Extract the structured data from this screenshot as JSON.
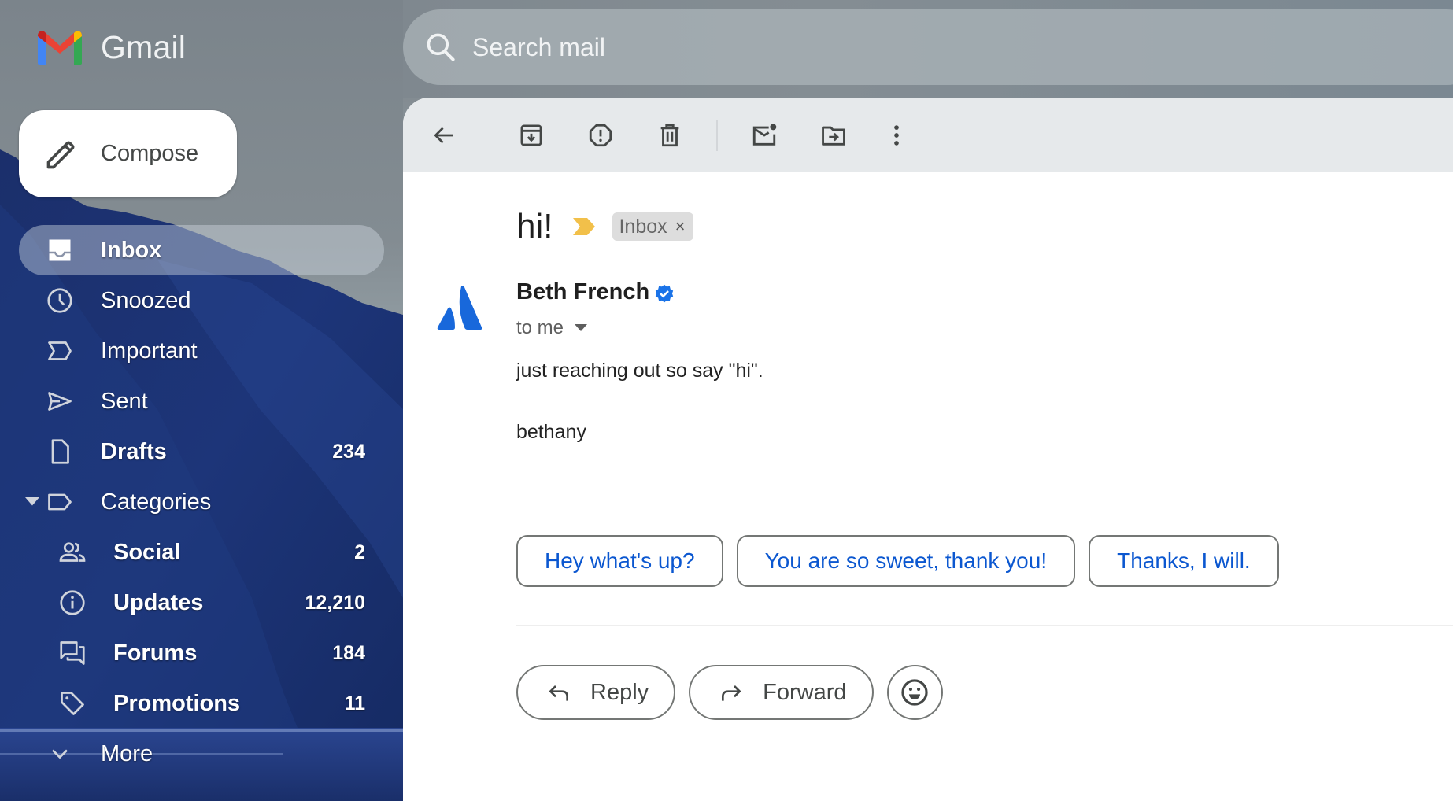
{
  "app": {
    "name": "Gmail",
    "logo_icon": "gmail-m-logo"
  },
  "search": {
    "placeholder": "Search mail",
    "value": "",
    "icon": "search-icon"
  },
  "compose": {
    "label": "Compose",
    "icon": "pencil-icon"
  },
  "sidebar": {
    "items": [
      {
        "label": "Inbox",
        "icon": "inbox-icon",
        "count": "",
        "active": true,
        "bold": true
      },
      {
        "label": "Snoozed",
        "icon": "clock-icon",
        "count": "",
        "active": false,
        "bold": false
      },
      {
        "label": "Important",
        "icon": "important-icon",
        "count": "",
        "active": false,
        "bold": false
      },
      {
        "label": "Sent",
        "icon": "send-icon",
        "count": "",
        "active": false,
        "bold": false
      },
      {
        "label": "Drafts",
        "icon": "draft-icon",
        "count": "234",
        "active": false,
        "bold": true
      },
      {
        "label": "Categories",
        "icon": "label-icon",
        "count": "",
        "active": false,
        "bold": false,
        "expanded": true
      },
      {
        "label": "Social",
        "icon": "people-icon",
        "count": "2",
        "active": false,
        "bold": true
      },
      {
        "label": "Updates",
        "icon": "info-icon",
        "count": "12,210",
        "active": false,
        "bold": true
      },
      {
        "label": "Forums",
        "icon": "forum-icon",
        "count": "184",
        "active": false,
        "bold": true
      },
      {
        "label": "Promotions",
        "icon": "tag-icon",
        "count": "11",
        "active": false,
        "bold": true
      },
      {
        "label": "More",
        "icon": "chevron-down-icon",
        "count": "",
        "active": false,
        "bold": false
      }
    ]
  },
  "toolbar": {
    "buttons": [
      {
        "name": "back",
        "icon": "arrow-back-icon",
        "tooltip": "Back to Inbox"
      },
      {
        "name": "archive",
        "icon": "archive-icon",
        "tooltip": "Archive"
      },
      {
        "name": "spam",
        "icon": "report-spam-icon",
        "tooltip": "Report spam"
      },
      {
        "name": "delete",
        "icon": "trash-icon",
        "tooltip": "Delete"
      },
      {
        "name": "mark-unread",
        "icon": "mark-unread-icon",
        "tooltip": "Mark as unread"
      },
      {
        "name": "move-to",
        "icon": "move-to-folder-icon",
        "tooltip": "Move to"
      },
      {
        "name": "more",
        "icon": "more-vert-icon",
        "tooltip": "More"
      }
    ]
  },
  "email": {
    "subject": "hi!",
    "importance_color": "#f2c04a",
    "label_chip": "Inbox",
    "label_chip_remove": "×",
    "sender": {
      "name": "Beth French",
      "verified": true,
      "avatar_color": "#1868db"
    },
    "recipient_summary": "to me",
    "body": [
      "just reaching out so say \"hi\".",
      "bethany"
    ]
  },
  "smart_replies": [
    "Hey what's up?",
    "You are so sweet, thank you!",
    "Thanks, I will."
  ],
  "actions": {
    "reply": "Reply",
    "forward": "Forward",
    "emoji_icon": "emoji-icon"
  },
  "colors": {
    "accent_blue": "#0b57d0",
    "verified_blue": "#1a73e8",
    "toolbar_bg": "#e6e9eb"
  }
}
